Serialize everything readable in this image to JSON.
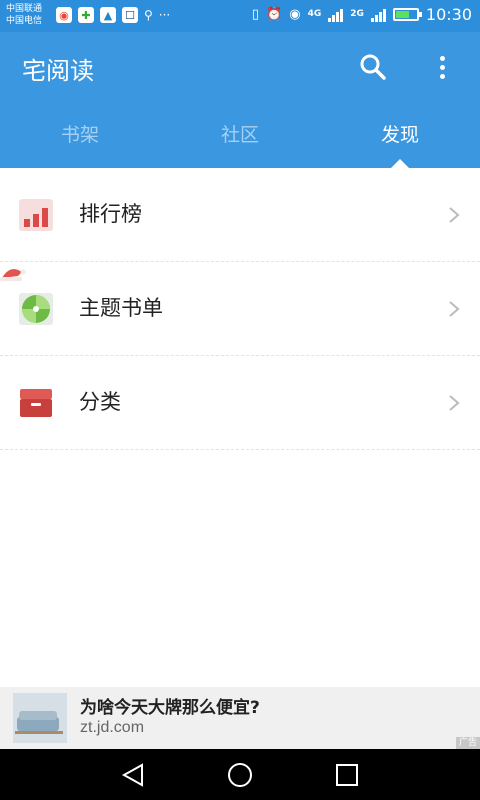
{
  "status_bar": {
    "carrier1": "中国联通",
    "carrier2": "中国电信",
    "overflow": "···",
    "net1": "4G",
    "net1_sub": "4G",
    "net2": "2G",
    "time": "10:30"
  },
  "app_bar": {
    "title": "宅阅读",
    "tabs": [
      {
        "label": "书架"
      },
      {
        "label": "社区"
      },
      {
        "label": "发现"
      }
    ],
    "accent": "#3b97e0"
  },
  "menu": {
    "items": [
      {
        "label": "排行榜",
        "icon": "ranking-chart-icon"
      },
      {
        "label": "主题书单",
        "icon": "theme-booklist-icon"
      },
      {
        "label": "分类",
        "icon": "category-box-icon"
      }
    ]
  },
  "ad": {
    "title": "为啥今天大牌那么便宜?",
    "url": "zt.jd.com",
    "badge": "广告"
  }
}
